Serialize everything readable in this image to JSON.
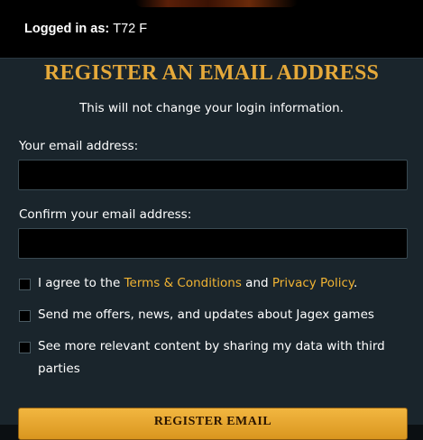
{
  "header": {
    "login_label": "Logged in as:",
    "username": "T72 F"
  },
  "form": {
    "title": "REGISTER AN EMAIL ADDRESS",
    "subtitle": "This will not change your login information.",
    "email_label": "Your email address:",
    "email_value": "",
    "confirm_label": "Confirm your email address:",
    "confirm_value": "",
    "agree_text_1": "I agree to the ",
    "terms_link": "Terms & Conditions",
    "agree_text_2": " and ",
    "privacy_link": "Privacy Policy",
    "agree_text_3": ".",
    "offers_text": "Send me offers, news, and updates about Jagex games",
    "share_text": "See more relevant content by sharing my data with third parties",
    "submit_label": "REGISTER EMAIL"
  },
  "colors": {
    "accent": "#e5a93a",
    "link": "#f0b333",
    "panel": "#1a252c",
    "topbar": "#000000"
  }
}
